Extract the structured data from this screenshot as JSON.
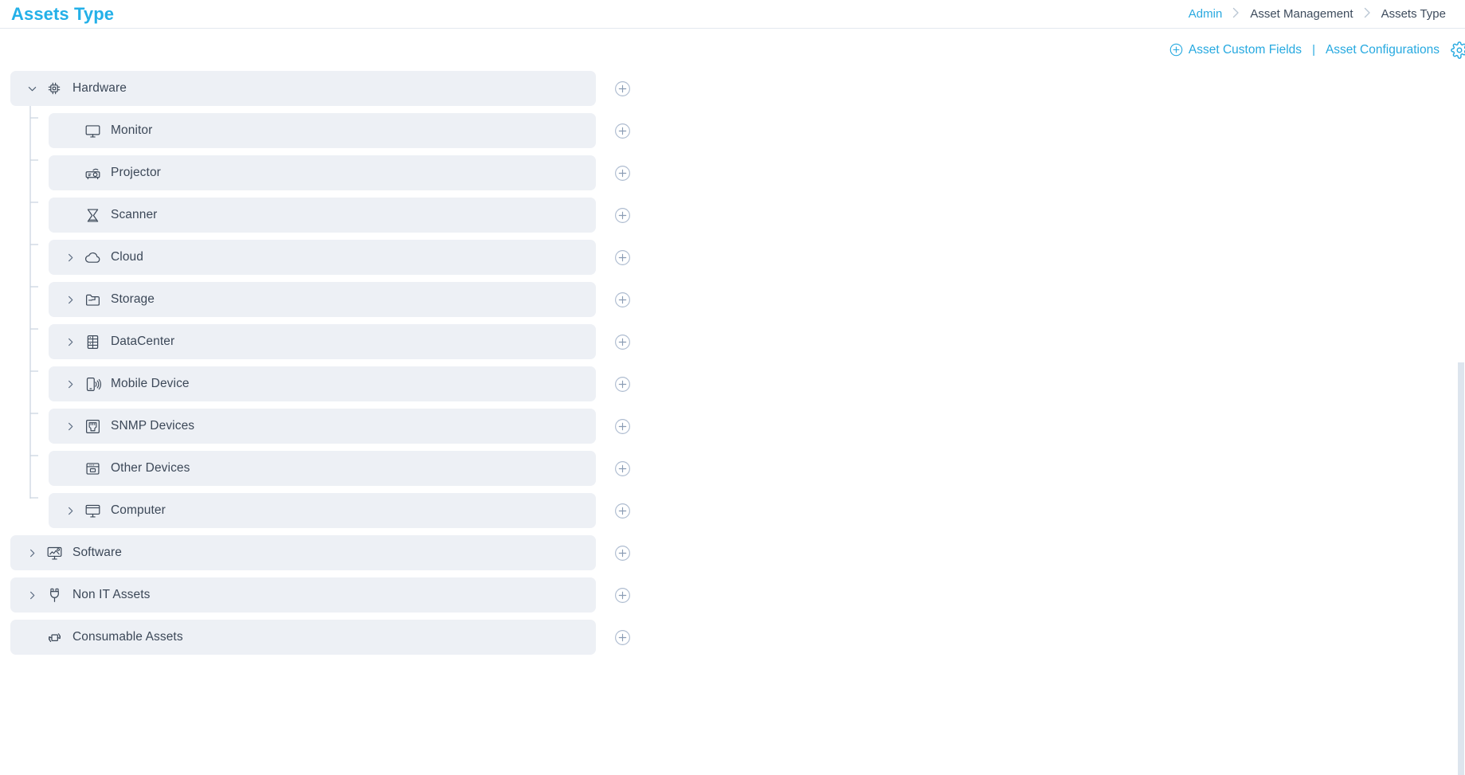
{
  "header": {
    "title": "Assets Type",
    "breadcrumb": [
      {
        "label": "Admin",
        "type": "link"
      },
      {
        "label": "Asset Management",
        "type": "link"
      },
      {
        "label": "Assets Type",
        "type": "current"
      }
    ],
    "separator": "›"
  },
  "actions": {
    "custom_fields_label": "Asset Custom Fields",
    "custom_fields_icon": "circle-plus-icon",
    "divider": "|",
    "configurations_label": "Asset Configurations",
    "settings_icon": "gear-icon",
    "accent_color": "#26a9e0"
  },
  "tree": {
    "add_icon": "circle-plus-icon",
    "rows": [
      {
        "label": "Hardware",
        "icon": "chip-icon",
        "level": 0,
        "state": "expanded",
        "add": true
      },
      {
        "label": "Monitor",
        "icon": "monitor-icon",
        "level": 1,
        "state": "leaf",
        "add": true
      },
      {
        "label": "Projector",
        "icon": "projector-icon",
        "level": 1,
        "state": "leaf",
        "add": true
      },
      {
        "label": "Scanner",
        "icon": "scanner-icon",
        "level": 1,
        "state": "leaf",
        "add": true
      },
      {
        "label": "Cloud",
        "icon": "cloud-icon",
        "level": 1,
        "state": "collapsed",
        "add": true
      },
      {
        "label": "Storage",
        "icon": "folder-icon",
        "level": 1,
        "state": "collapsed",
        "add": true
      },
      {
        "label": "DataCenter",
        "icon": "datacenter-icon",
        "level": 1,
        "state": "collapsed",
        "add": true
      },
      {
        "label": "Mobile Device",
        "icon": "mobile-icon",
        "level": 1,
        "state": "collapsed",
        "add": true
      },
      {
        "label": "SNMP Devices",
        "icon": "ethernet-port-icon",
        "level": 1,
        "state": "collapsed",
        "add": true
      },
      {
        "label": "Other Devices",
        "icon": "device-box-icon",
        "level": 1,
        "state": "leaf",
        "add": true
      },
      {
        "label": "Computer",
        "icon": "desktop-icon",
        "level": 1,
        "state": "collapsed",
        "add": true
      },
      {
        "label": "Software",
        "icon": "software-icon",
        "level": 0,
        "state": "collapsed",
        "add": true
      },
      {
        "label": "Non IT Assets",
        "icon": "plug-icon",
        "level": 0,
        "state": "collapsed",
        "add": true
      },
      {
        "label": "Consumable Assets",
        "icon": "recycle-box-icon",
        "level": 0,
        "state": "leaf",
        "add": true
      }
    ]
  },
  "colors": {
    "row_background": "#edf0f5",
    "accent": "#26a9e0",
    "text": "#3c4858",
    "title": "#23b0e8"
  }
}
